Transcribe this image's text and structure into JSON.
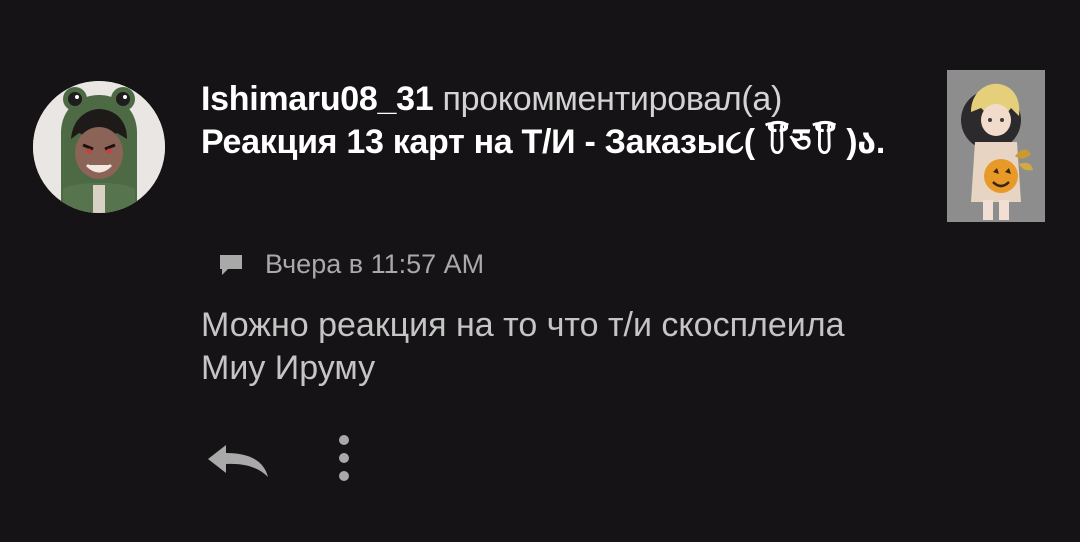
{
  "notification": {
    "username": "Ishimaru08_31",
    "action": "прокомментировал(а)",
    "post_title": "Реакция 13 карт на Т/И - Заказы૮( ꒦ິཅ꒦ິ )ა.",
    "timestamp": "Вчера в 11:57 AM",
    "comment": "Можно реакция на то что т/и скосплеила Миу Ируму",
    "icons": {
      "avatar": "user-avatar",
      "thumbnail": "post-thumbnail",
      "timestamp": "comment-bubble-icon",
      "reply": "reply-arrow-icon",
      "more": "more-vertical-icon"
    }
  }
}
